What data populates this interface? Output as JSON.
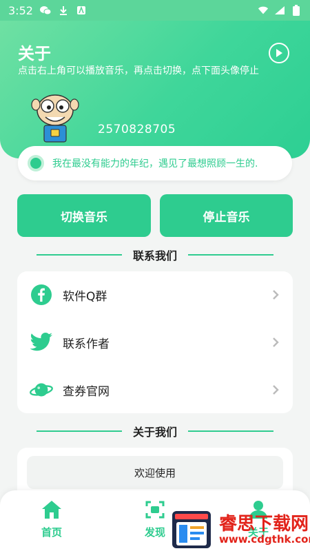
{
  "status_bar": {
    "time": "3:52"
  },
  "header": {
    "title": "关于",
    "subtitle": "点击右上角可以播放音乐，再点击切换，点下面头像停止",
    "user_id": "2570828705"
  },
  "motto": {
    "text": "我在最没有能力的年纪，遇见了最想照顾一生的."
  },
  "buttons": {
    "switch_music": "切换音乐",
    "stop_music": "停止音乐"
  },
  "contact": {
    "title": "联系我们",
    "items": [
      {
        "label": "软件Q群",
        "icon": "facebook-icon"
      },
      {
        "label": "联系作者",
        "icon": "twitter-icon"
      },
      {
        "label": "查券官网",
        "icon": "planet-icon"
      }
    ]
  },
  "about": {
    "title": "关于我们",
    "welcome": "欢迎使用"
  },
  "nav": {
    "home": "首页",
    "find": "发现",
    "about": "关于"
  },
  "watermark": {
    "text": "睿思下载网",
    "url": "www.cdgthk.com"
  },
  "colors": {
    "accent": "#2ecc8f",
    "watermark": "#e2231a"
  }
}
